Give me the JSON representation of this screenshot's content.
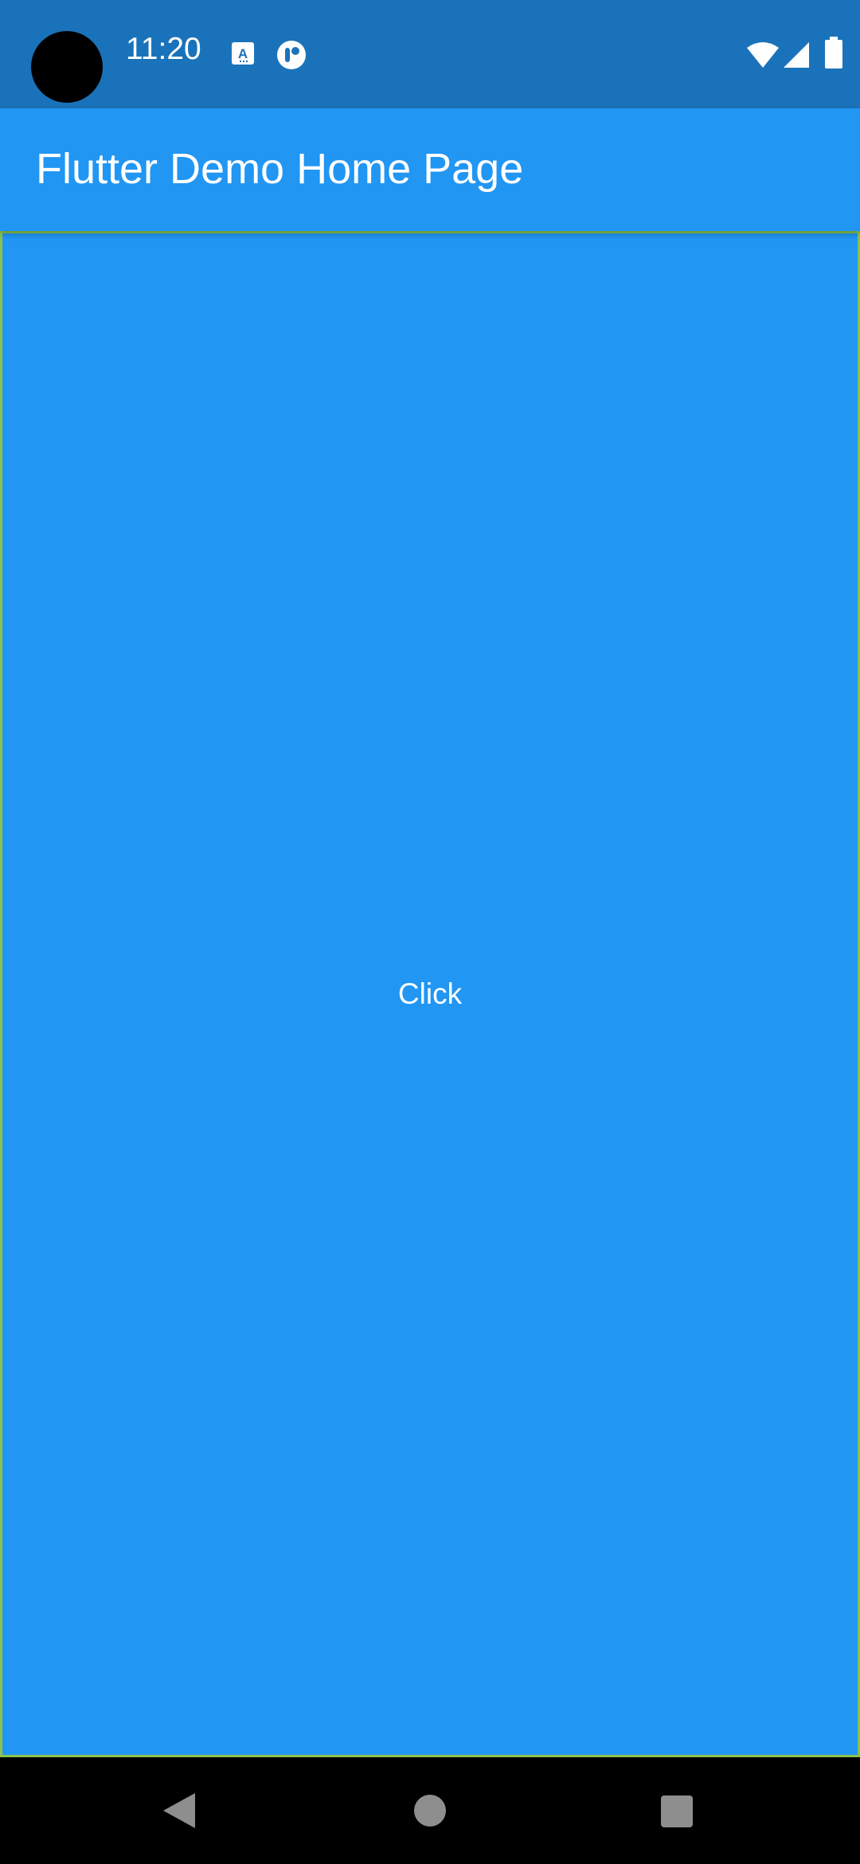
{
  "status_bar": {
    "time": "11:20",
    "icons": [
      "camera-hole",
      "a-icon",
      "r-icon",
      "wifi-icon",
      "signal-icon",
      "battery-icon"
    ],
    "background_color": "#1A73BA"
  },
  "app_bar": {
    "title": "Flutter Demo Home Page",
    "background_color": "#2196F3"
  },
  "content": {
    "background_color": "#2196F3",
    "button_label": "Click"
  },
  "nav_bar": {
    "icons": [
      "back-icon",
      "home-icon",
      "recents-icon"
    ]
  }
}
